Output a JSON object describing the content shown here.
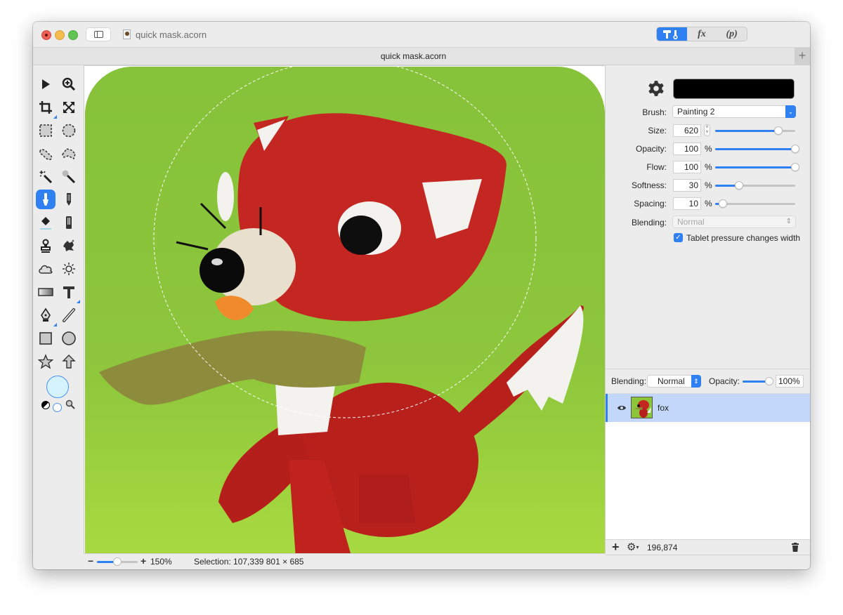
{
  "window": {
    "title": "quick mask.acorn",
    "document_tab_title": "quick mask.acorn",
    "new_tab_label": "+"
  },
  "toolbar_segments": [
    {
      "name": "tools",
      "label": "",
      "icon": "hammer-wrench-icon",
      "active": true
    },
    {
      "name": "filters",
      "label": "fx",
      "active": false
    },
    {
      "name": "plugins",
      "label": "(p)",
      "active": false
    }
  ],
  "tools": [
    {
      "name": "move-tool",
      "icon": "arrow-pointer-icon"
    },
    {
      "name": "zoom-tool",
      "icon": "zoom-in-icon"
    },
    {
      "name": "crop-tool",
      "icon": "crop-icon"
    },
    {
      "name": "transform-tool",
      "icon": "expand-arrows-icon"
    },
    {
      "name": "rect-select-tool",
      "icon": "rect-marquee-icon"
    },
    {
      "name": "ellipse-select-tool",
      "icon": "ellipse-marquee-icon"
    },
    {
      "name": "lasso-tool",
      "icon": "lasso-icon"
    },
    {
      "name": "polygon-lasso-tool",
      "icon": "polygon-lasso-icon"
    },
    {
      "name": "magic-wand-tool",
      "icon": "magic-wand-icon"
    },
    {
      "name": "instant-alpha-tool",
      "icon": "instant-alpha-icon"
    },
    {
      "name": "brush-tool",
      "icon": "brush-icon",
      "active": true
    },
    {
      "name": "pencil-tool",
      "icon": "pencil-icon"
    },
    {
      "name": "paint-bucket-tool",
      "icon": "paint-bucket-icon"
    },
    {
      "name": "eraser-tool",
      "icon": "eraser-icon"
    },
    {
      "name": "clone-tool",
      "icon": "stamp-icon"
    },
    {
      "name": "smudge-tool",
      "icon": "splatter-icon"
    },
    {
      "name": "burn-tool",
      "icon": "cloud-icon"
    },
    {
      "name": "dodge-tool",
      "icon": "sun-icon"
    },
    {
      "name": "gradient-tool",
      "icon": "gradient-icon"
    },
    {
      "name": "text-tool",
      "icon": "text-icon"
    },
    {
      "name": "pen-tool",
      "icon": "pen-nib-icon"
    },
    {
      "name": "line-tool",
      "icon": "line-icon"
    },
    {
      "name": "rectangle-tool",
      "icon": "rectangle-icon"
    },
    {
      "name": "oval-tool",
      "icon": "circle-icon"
    },
    {
      "name": "star-tool",
      "icon": "star-icon"
    },
    {
      "name": "arrow-tool",
      "icon": "up-arrow-icon"
    }
  ],
  "colors": {
    "fill_color": "#d4f3ff",
    "brush_color": "#000000",
    "accent": "#2f80f0",
    "selected_row": "#c2d7fa"
  },
  "brush_settings": {
    "brush_label": "Brush:",
    "brush_value": "Painting 2",
    "size_label": "Size:",
    "size_value": "620",
    "size_fraction": 0.79,
    "opacity_label": "Opacity:",
    "opacity_value": "100",
    "opacity_fraction": 1.0,
    "flow_label": "Flow:",
    "flow_value": "100",
    "flow_fraction": 1.0,
    "softness_label": "Softness:",
    "softness_value": "30",
    "softness_fraction": 0.3,
    "spacing_label": "Spacing:",
    "spacing_value": "10",
    "spacing_fraction": 0.1,
    "percent": "%",
    "blending_label": "Blending:",
    "blending_value": "Normal",
    "tablet_label": "Tablet pressure changes width",
    "tablet_checked": true
  },
  "layers_panel": {
    "blending_label": "Blending:",
    "blending_value": "Normal",
    "opacity_label": "Opacity:",
    "opacity_value": "100%",
    "opacity_fraction": 1.0,
    "layers": [
      {
        "name": "fox",
        "visible": true,
        "selected": true
      }
    ],
    "footer_count": "196,874"
  },
  "status": {
    "zoom_minus": "−",
    "zoom_plus": "+",
    "zoom_level": "150%",
    "zoom_fraction": 0.5,
    "selection_text": "Selection: 107,339 801 × 685"
  }
}
